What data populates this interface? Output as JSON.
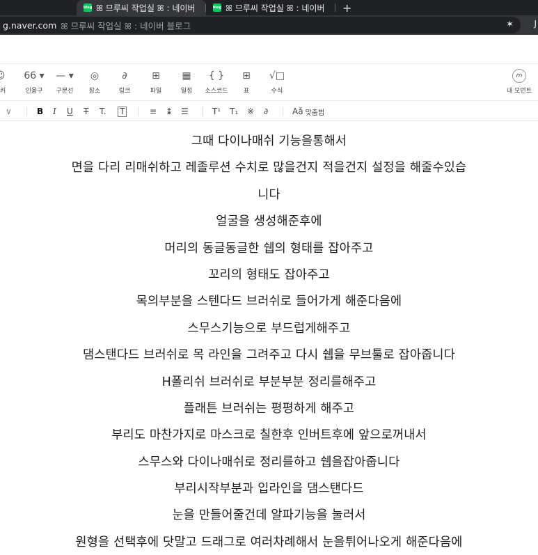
{
  "browser": {
    "tabs": [
      {
        "favicon": "blog",
        "title": "ꕤ 므루씨 작업실 ꕤ : 네이버"
      },
      {
        "favicon": "blog",
        "title": "ꕤ 므루씨 작업실 ꕤ : 네이버"
      }
    ],
    "new_tab_icon": "+",
    "address": {
      "host": "g.naver.com",
      "title": "ꕤ 므루씨 작업실 ꕤ : 네이버 블로그"
    },
    "edge_letter": "J"
  },
  "insert_toolbar": [
    {
      "icon": "sticker-icon",
      "glyph": "☺",
      "label": "티커"
    },
    {
      "icon": "quote-icon",
      "glyph": "66 ▾",
      "label": "인용구"
    },
    {
      "icon": "divider-icon",
      "glyph": "— ▾",
      "label": "구분선"
    },
    {
      "icon": "location-icon",
      "glyph": "◎",
      "label": "장소"
    },
    {
      "icon": "link-icon",
      "glyph": "∂",
      "label": "링크"
    },
    {
      "icon": "file-icon",
      "glyph": "⊞",
      "label": "파일"
    },
    {
      "icon": "schedule-icon",
      "glyph": "▦",
      "label": "일정"
    },
    {
      "icon": "code-icon",
      "glyph": "{ }",
      "label": "소스코드"
    },
    {
      "icon": "table-icon",
      "glyph": "⊞",
      "label": "표"
    },
    {
      "icon": "formula-icon",
      "glyph": "√□",
      "label": "수식"
    }
  ],
  "moment": {
    "icon": "moment-icon",
    "glyph": "m",
    "label": "내 모먼트"
  },
  "format_toolbar": {
    "dropdown": "∨",
    "bold": "B",
    "italic": "I",
    "underline": "U",
    "strike": "T",
    "text_color": "T.",
    "bg_color": "T",
    "align": "≡",
    "line_height": "↨",
    "list": "☰",
    "superscript": "T¹",
    "subscript": "T₁",
    "special_char": "※",
    "link": "∂",
    "spellcheck_icon": "Aǎ",
    "spellcheck_label": "맞춤법"
  },
  "content": {
    "lines": [
      "그때 다이나매쉬 기능을통해서",
      "면을 다리 리매쉬하고 레졸루션 수치로 많을건지 적을건지 설정을 해줄수있습",
      "니다",
      "얼굴을 생성해준후에",
      "머리의 동글동글한 쉡의 형태를 잡아주고",
      "꼬리의 형태도 잡아주고",
      "목의부분을 스텐다드 브러쉬로 들어가게 해준다음에",
      "스무스기능으로 부드럽게해주고",
      "댐스탠다드 브러쉬로 목 라인을 그려주고 다시 쉡을 무브툴로 잡아줍니다",
      "H폴리쉬 브러쉬로 부분부분 정리를해주고",
      "플래튼 브러쉬는 평평하게 해주고",
      "부리도 마찬가지로 마스크로 칠한후 인버트후에 앞으로꺼내서",
      "스무스와 다이나매쉬로 정리를하고 쉡을잡아줍니다",
      "부리시작부분과 입라인을 댐스탠다드",
      "눈을 만들어줄건데 알파기능을 눌러서",
      "원형을 선택후에 닷말고 드래그로 여러차례해서 눈을튀어나오게 해준다음에"
    ]
  }
}
